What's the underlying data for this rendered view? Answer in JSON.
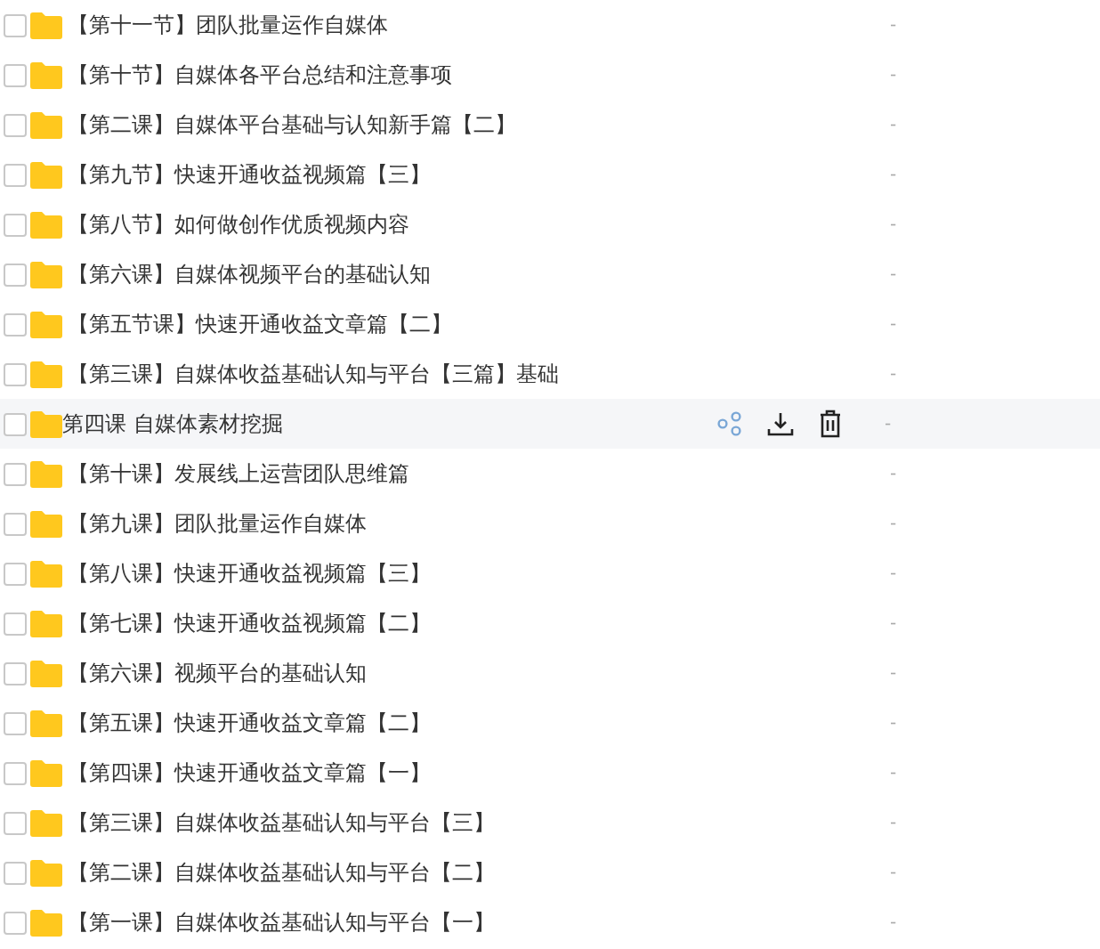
{
  "files": [
    {
      "name": "【第十一节】团队批量运作自媒体",
      "size": "-",
      "checked": false,
      "hovered": false
    },
    {
      "name": "【第十节】自媒体各平台总结和注意事项",
      "size": "-",
      "checked": false,
      "hovered": false
    },
    {
      "name": "【第二课】自媒体平台基础与认知新手篇【二】",
      "size": "-",
      "checked": false,
      "hovered": false
    },
    {
      "name": "【第九节】快速开通收益视频篇【三】",
      "size": "-",
      "checked": false,
      "hovered": false
    },
    {
      "name": "【第八节】如何做创作优质视频内容",
      "size": "-",
      "checked": false,
      "hovered": false
    },
    {
      "name": "【第六课】自媒体视频平台的基础认知",
      "size": "-",
      "checked": false,
      "hovered": false
    },
    {
      "name": "【第五节课】快速开通收益文章篇【二】",
      "size": "-",
      "checked": false,
      "hovered": false
    },
    {
      "name": "【第三课】自媒体收益基础认知与平台【三篇】基础",
      "size": "-",
      "checked": false,
      "hovered": false
    },
    {
      "name": "第四课 自媒体素材挖掘",
      "size": "-",
      "checked": false,
      "hovered": true
    },
    {
      "name": "【第十课】发展线上运营团队思维篇",
      "size": "-",
      "checked": false,
      "hovered": false
    },
    {
      "name": "【第九课】团队批量运作自媒体",
      "size": "-",
      "checked": false,
      "hovered": false
    },
    {
      "name": "【第八课】快速开通收益视频篇【三】",
      "size": "-",
      "checked": false,
      "hovered": false
    },
    {
      "name": "【第七课】快速开通收益视频篇【二】",
      "size": "-",
      "checked": false,
      "hovered": false
    },
    {
      "name": "【第六课】视频平台的基础认知",
      "size": "-",
      "checked": false,
      "hovered": false
    },
    {
      "name": "【第五课】快速开通收益文章篇【二】",
      "size": "-",
      "checked": false,
      "hovered": false
    },
    {
      "name": "【第四课】快速开通收益文章篇【一】",
      "size": "-",
      "checked": false,
      "hovered": false
    },
    {
      "name": "【第三课】自媒体收益基础认知与平台【三】",
      "size": "-",
      "checked": false,
      "hovered": false
    },
    {
      "name": "【第二课】自媒体收益基础认知与平台【二】",
      "size": "-",
      "checked": false,
      "hovered": false
    },
    {
      "name": "【第一课】自媒体收益基础认知与平台【一】",
      "size": "-",
      "checked": false,
      "hovered": false
    }
  ]
}
